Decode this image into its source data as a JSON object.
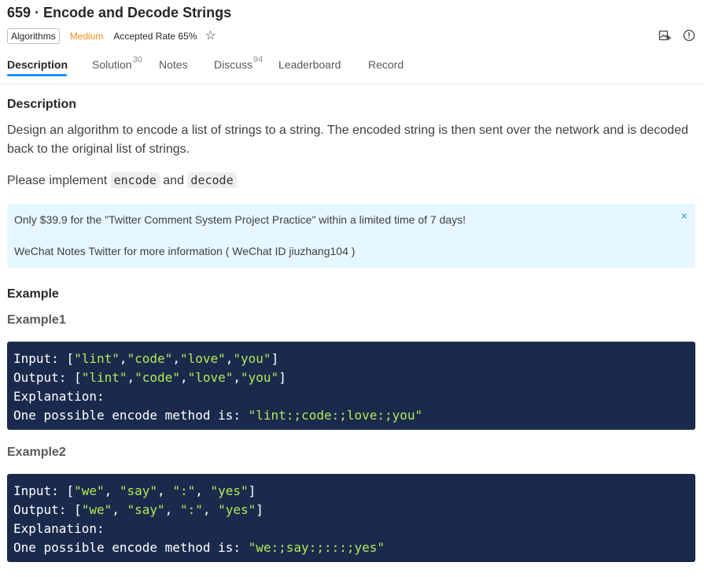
{
  "header": {
    "title": "659 · Encode and Decode Strings",
    "tag": "Algorithms",
    "difficulty": "Medium",
    "accepted_rate": "Accepted Rate 65%",
    "icons": [
      "star-icon",
      "image-add-icon",
      "info-icon"
    ]
  },
  "tabs": [
    {
      "label": "Description",
      "count": ""
    },
    {
      "label": "Solution",
      "count": "30"
    },
    {
      "label": "Notes",
      "count": ""
    },
    {
      "label": "Discuss",
      "count": "94"
    },
    {
      "label": "Leaderboard",
      "count": ""
    },
    {
      "label": "Record",
      "count": ""
    }
  ],
  "description": {
    "heading": "Description",
    "text": "Design an algorithm to encode a list of strings to a string. The encoded string is then sent over the network and is decoded back to the original list of strings.",
    "impl_prefix": "Please implement",
    "impl_encode": "encode",
    "impl_and": "and",
    "impl_decode": "decode"
  },
  "banner": {
    "line1": "Only $39.9 for the \"Twitter Comment System Project Practice\" within a limited time of 7 days!",
    "line2": "WeChat Notes Twitter for more information ( WeChat ID jiuzhang104 )",
    "close": "×"
  },
  "example": {
    "heading": "Example",
    "ex1_title": "Example1",
    "ex1": {
      "input_label": "Input: ",
      "input_open": "[",
      "input_items": [
        "\"lint\"",
        "\"code\"",
        "\"love\"",
        "\"you\""
      ],
      "output_label": "Output: ",
      "explanation": "Explanation:",
      "method_label": "One possible encode method is: ",
      "method_value": "\"lint:;code:;love:;you\""
    },
    "ex2_title": "Example2",
    "ex2": {
      "input_label": "Input: ",
      "input_items": [
        "\"we\"",
        "\"say\"",
        "\":\"",
        "\"yes\""
      ],
      "output_label": "Output: ",
      "explanation": "Explanation:",
      "method_label": "One possible encode method is: ",
      "method_value": "\"we:;say:;:::;yes\""
    }
  },
  "colors": {
    "accent": "#1890ff",
    "difficulty": "#fa8c16",
    "code_bg": "#1a2a4d",
    "code_string": "#b5e853",
    "banner_bg": "#e6f7ff"
  }
}
